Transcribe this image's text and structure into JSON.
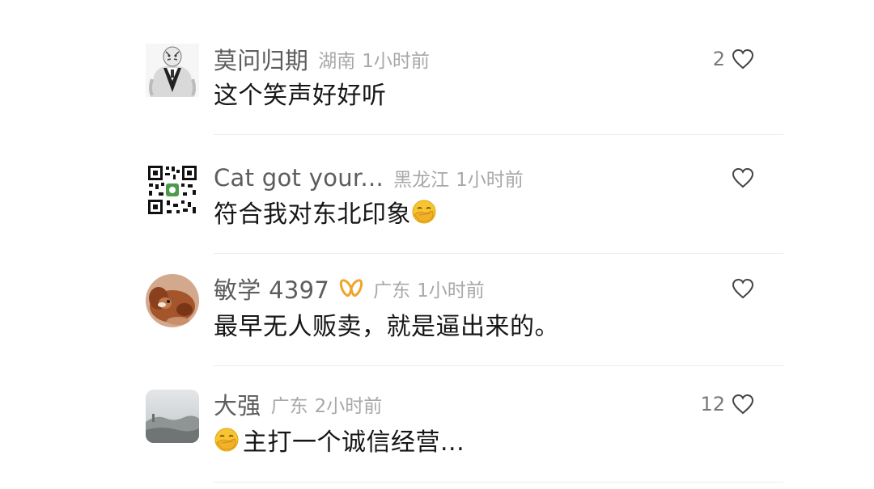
{
  "comments": [
    {
      "username": "莫问归期",
      "location": "湖南",
      "time": "1小时前",
      "likes": "2",
      "text": "这个笑声好好听",
      "avatar_icon": "tiger-suit-avatar"
    },
    {
      "username": "Cat got your...",
      "location": "黑龙江",
      "time": "1小时前",
      "likes": "",
      "text": "符合我对东北印象",
      "avatar_icon": "qr-code-avatar",
      "trailing_emoji": "facepalm-emoji"
    },
    {
      "username": "敏学 4397",
      "location": "广东",
      "time": "1小时前",
      "likes": "",
      "text": "最早无人贩卖，就是逼出来的。",
      "avatar_icon": "puppy-avatar",
      "badge": "butterfly-badge-icon"
    },
    {
      "username": "大强",
      "location": "广东",
      "time": "2小时前",
      "likes": "12",
      "text": "主打一个诚信经营...",
      "avatar_icon": "foggy-landscape-avatar",
      "leading_emoji": "facepalm-emoji"
    }
  ],
  "colors": {
    "username": "#5d5d5d",
    "meta": "#a8a8a8",
    "text": "#161616",
    "badge": "#f0a429",
    "divider": "#ececec"
  }
}
